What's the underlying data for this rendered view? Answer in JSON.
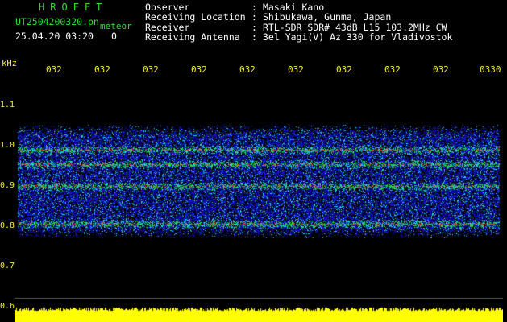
{
  "header": {
    "title": "HROFFT",
    "filename": "UT2504200320.pn",
    "meteor_label": "meteor",
    "datetime": "25.04.20 03:20",
    "meteor_count": "0"
  },
  "info": {
    "rows": [
      {
        "label": "Observer",
        "value": "Masaki Kano"
      },
      {
        "label": "Receiving Location",
        "value": "Shibukawa, Gunma, Japan"
      },
      {
        "label": "Receiver",
        "value": "RTL-SDR SDR# 43dB L15 103.2MHz CW"
      },
      {
        "label": "Receiving Antenna",
        "value": "3el Yagi(V) Az 330 for Vladivostok"
      }
    ],
    "separator": ":"
  },
  "axes": {
    "y_unit": "kHz",
    "y_ticks": [
      "1.1",
      "1.0",
      "0.9",
      "0.8",
      "0.7",
      "0.6"
    ],
    "x_ticks": [
      "032",
      "032",
      "032",
      "032",
      "032",
      "032",
      "032",
      "032",
      "032",
      "0330"
    ]
  },
  "colors": {
    "background": "#000000",
    "axis_text": "#f3ef2f",
    "title": "#2ee02e",
    "info_text": "#ffffff",
    "noise_blue": "#1414d0",
    "signal_cyan": "#1fd8d8",
    "signal_green": "#28d028",
    "signal_red": "#e02020",
    "amplitude": "#ffff00"
  }
}
